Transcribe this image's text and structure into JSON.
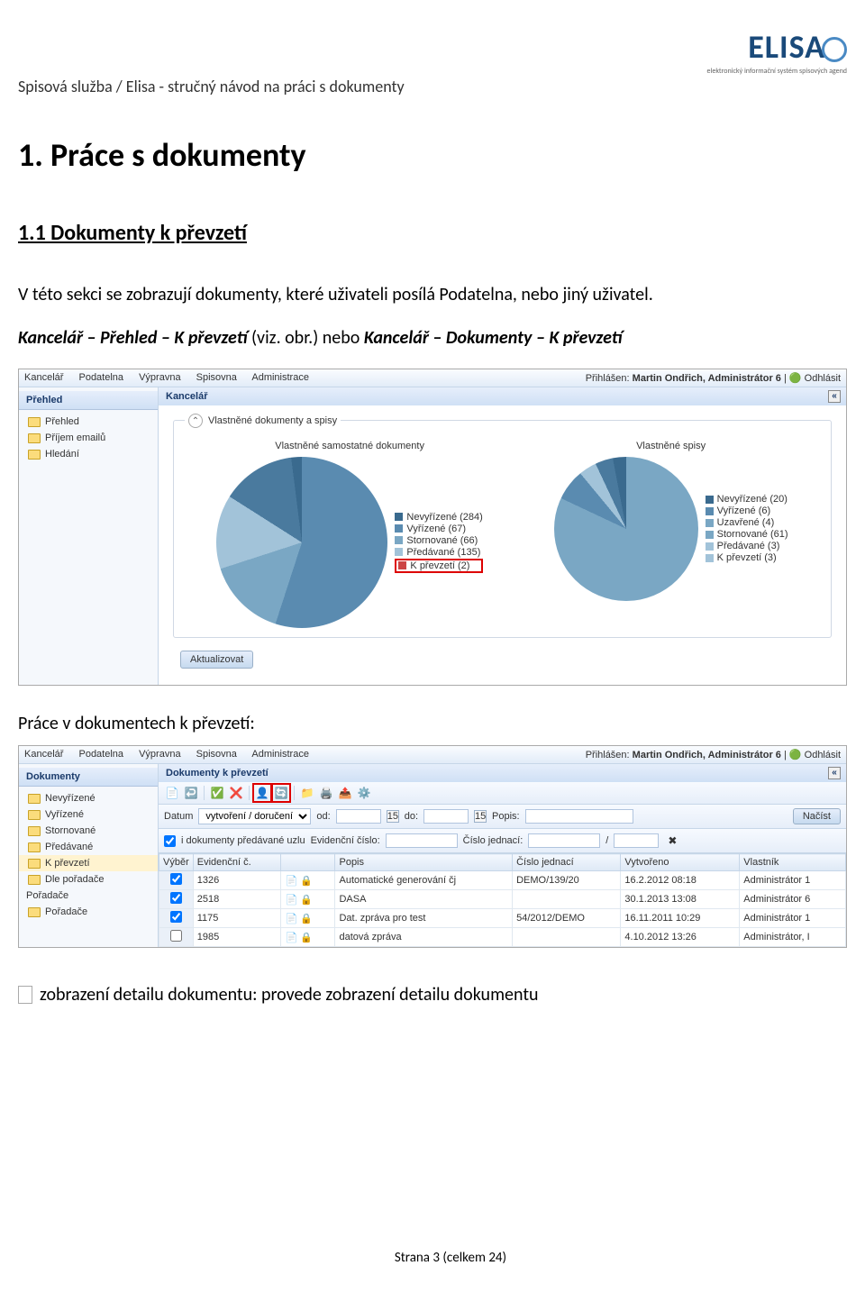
{
  "header": {
    "breadcrumb": "Spisová služba / Elisa - stručný návod na práci s dokumenty",
    "logo_main": "ELISA",
    "logo_sub": "elektronický informační systém spisových agend"
  },
  "h1": "1.  Práce s dokumenty",
  "h2": "1.1   Dokumenty k převzetí",
  "para1": "V této sekci se zobrazují dokumenty, které uživateli posílá Podatelna, nebo jiný uživatel.",
  "para2_prefix": "",
  "para2_path": "Kancelář – Přehled – K převzetí",
  "para2_mid": " (viz. obr.) nebo ",
  "para2_path2": "Kancelář – Dokumenty – K převzetí",
  "screenshot1": {
    "menu": [
      "Kancelář",
      "Podatelna",
      "Výpravna",
      "Spisovna",
      "Administrace"
    ],
    "user_label": "Přihlášen:",
    "user": "Martin Ondřich, Administrátor 6",
    "logout": "Odhlásit",
    "side_head": "Přehled",
    "side_items": [
      "Přehled",
      "Příjem emailů",
      "Hledání"
    ],
    "main_head": "Kancelář",
    "collapse": "«",
    "fieldset_title": "Vlastněné dokumenty a spisy",
    "pie1_title": "Vlastněné samostatné dokumenty",
    "pie2_title": "Vlastněné spisy",
    "legend1": [
      "Nevyřízené (284)",
      "Vyřízené (67)",
      "Stornované (66)",
      "Předávané (135)",
      "K převzetí (2)"
    ],
    "legend2": [
      "Nevyřízené (20)",
      "Vyřízené (6)",
      "Uzavřené (4)",
      "Stornované (61)",
      "Předávané (3)",
      "K převzetí (3)"
    ],
    "refresh_btn": "Aktualizovat"
  },
  "caption2": "Práce v dokumentech k převzetí:",
  "screenshot2": {
    "menu": [
      "Kancelář",
      "Podatelna",
      "Výpravna",
      "Spisovna",
      "Administrace"
    ],
    "user_label": "Přihlášen:",
    "user": "Martin Ondřich, Administrátor 6",
    "logout": "Odhlásit",
    "side_head": "Dokumenty",
    "side_items": [
      "Nevyřízené",
      "Vyřízené",
      "Stornované",
      "Předávané",
      "K převzetí",
      "Dle pořadače"
    ],
    "side_cat": "Pořadače",
    "side_cat_items": [
      "Pořadače"
    ],
    "main_head": "Dokumenty k převzetí",
    "collapse": "«",
    "filter": {
      "date_lbl": "Datum",
      "date_sel": "vytvoření / doručení",
      "od_lbl": "od:",
      "do_lbl": "do:",
      "od_v": "15",
      "do_v": "15",
      "popis_lbl": "Popis:",
      "load_btn": "Načíst",
      "also_lbl": "i dokumenty předávané uzlu",
      "ec_lbl": "Evidenční číslo:",
      "cj_lbl": "Číslo jednací:"
    },
    "cols": [
      "Výběr",
      "Evidenční č.",
      "",
      "Popis",
      "Číslo jednací",
      "Vytvořeno",
      "Vlastník"
    ],
    "rows": [
      {
        "chk": true,
        "ec": "1326",
        "popis": "Automatické generování čj",
        "cj": "DEMO/139/20",
        "dat": "16.2.2012 08:18",
        "vl": "Administrátor 1"
      },
      {
        "chk": true,
        "ec": "2518",
        "popis": "DASA",
        "cj": "",
        "dat": "30.1.2013 13:08",
        "vl": "Administrátor 6"
      },
      {
        "chk": true,
        "ec": "1175",
        "popis": "Dat. zpráva pro test",
        "cj": "54/2012/DEMO",
        "dat": "16.11.2011 10:29",
        "vl": "Administrátor 1"
      },
      {
        "chk": false,
        "ec": "1985",
        "popis": "datová zpráva",
        "cj": "",
        "dat": "4.10.2012 13:26",
        "vl": "Administrátor, I"
      }
    ]
  },
  "iconline": " zobrazení detailu dokumentu: provede zobrazení detailu dokumentu",
  "footer": "Strana 3 (celkem 24)",
  "chart_data": [
    {
      "type": "pie",
      "title": "Vlastněné samostatné dokumenty",
      "categories": [
        "Nevyřízené",
        "Vyřízené",
        "Stornované",
        "Předávané",
        "K převzetí"
      ],
      "values": [
        284,
        67,
        66,
        135,
        2
      ]
    },
    {
      "type": "pie",
      "title": "Vlastněné spisy",
      "categories": [
        "Nevyřízené",
        "Vyřízené",
        "Uzavřené",
        "Stornované",
        "Předávané",
        "K převzetí"
      ],
      "values": [
        20,
        6,
        4,
        61,
        3,
        3
      ]
    }
  ]
}
